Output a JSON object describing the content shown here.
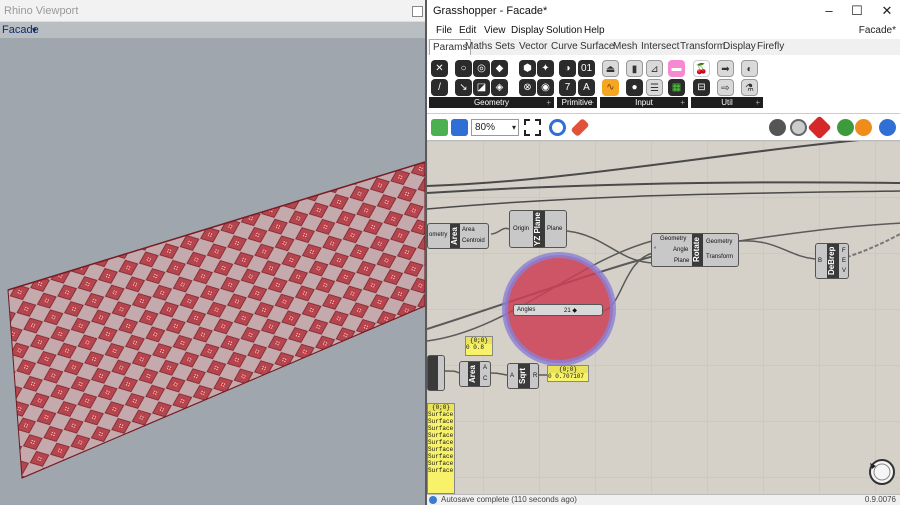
{
  "rhino": {
    "title": "Rhino Viewport",
    "view_label": "Facade",
    "view_arrow": "▾",
    "max_icon": "maximize-icon",
    "panel_color": "#b0323a"
  },
  "grasshopper": {
    "title": "Grasshopper - Facade*",
    "doc_name": "Facade*",
    "window_buttons": {
      "minimize": "–",
      "maximize": "☐",
      "close": "✕"
    },
    "menu": [
      "File",
      "Edit",
      "View",
      "Display",
      "Solution",
      "Help"
    ],
    "tabs": [
      "Params",
      "Maths",
      "Sets",
      "Vector",
      "Curve",
      "Surface",
      "Mesh",
      "Intersect",
      "Transform",
      "Display",
      "Firefly"
    ],
    "active_tab": "Params",
    "ribbon_panels": [
      {
        "label": "Geometry",
        "plus": "+"
      },
      {
        "label": "Primitive",
        "plus": "+"
      },
      {
        "label": "Input",
        "plus": "+"
      },
      {
        "label": "Util",
        "plus": "+"
      }
    ],
    "zoom": "80%",
    "zoom_arrow": "▾",
    "canvas": {
      "area_left": {
        "input": "ometry",
        "name": "Area",
        "outputs": [
          "Area",
          "Centroid"
        ]
      },
      "yz_plane": {
        "input": "Origin",
        "name": "YZ Plane",
        "output": "Plane"
      },
      "rotate": {
        "inputs": [
          "Geometry",
          "Angle",
          "Plane"
        ],
        "name": "Rotate",
        "outputs": [
          "Geometry",
          "Transform"
        ],
        "marker": "°"
      },
      "debrep": {
        "name": "DeBrep"
      },
      "slider": {
        "label": "Angles",
        "value": "21 ◆"
      },
      "area_bottom": {
        "name": "Area",
        "outputs": [
          "A",
          "C"
        ]
      },
      "sqrt": {
        "name": "Sqrt"
      },
      "panel_small": {
        "header": "{0;0}",
        "value": "0 0.8"
      },
      "panel_value": {
        "header": "{0;0}",
        "value": "0 0.707107"
      },
      "panel_list": {
        "header": "{0;0}",
        "items": [
          "Surface",
          "Surface",
          "Surface",
          "Surface",
          "Surface",
          "Surface",
          "Surface",
          "Surface",
          "Surface"
        ]
      },
      "highlight_color": "#cc3f55"
    },
    "status": "Autosave complete (110 seconds ago)",
    "version": "0.9.0076"
  }
}
